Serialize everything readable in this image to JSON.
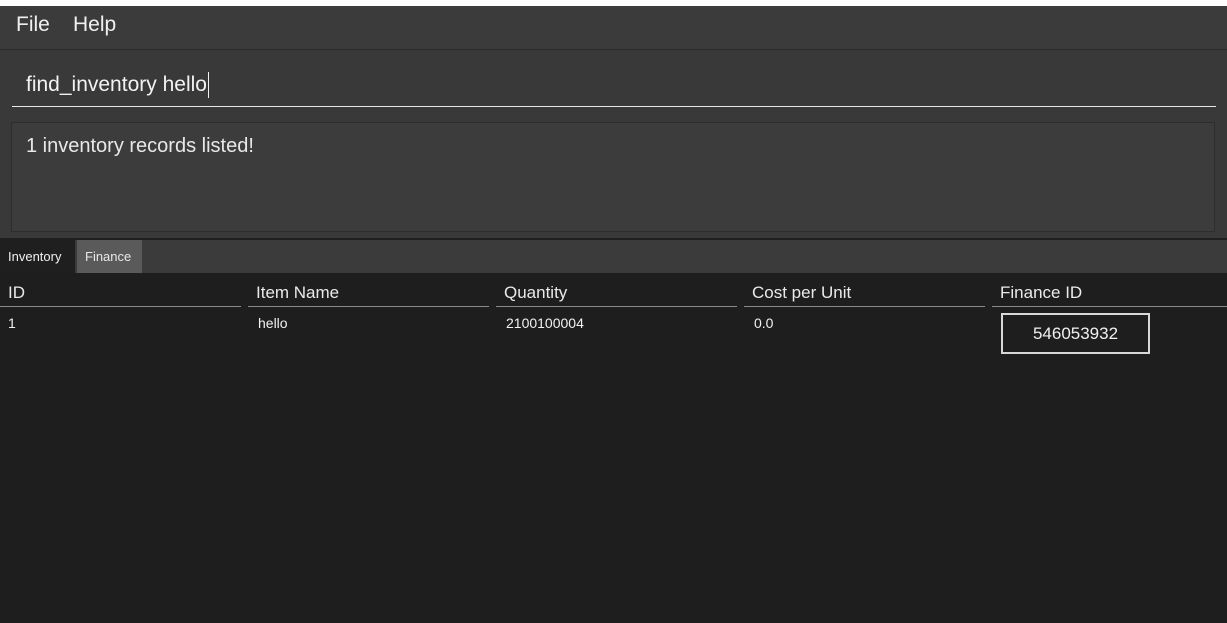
{
  "menu": {
    "file_label": "File",
    "help_label": "Help"
  },
  "command": {
    "value": "find_inventory hello"
  },
  "result": {
    "message": "1 inventory records listed!"
  },
  "tabs": [
    {
      "label": "Inventory",
      "active": true
    },
    {
      "label": "Finance",
      "active": false
    }
  ],
  "table": {
    "columns": [
      "ID",
      "Item Name",
      "Quantity",
      "Cost per Unit",
      "Finance ID"
    ],
    "rows": [
      {
        "id": "1",
        "item_name": "hello",
        "quantity": "2100100004",
        "cost_per_unit": "0.0",
        "finance_id": "546053932"
      }
    ]
  }
}
